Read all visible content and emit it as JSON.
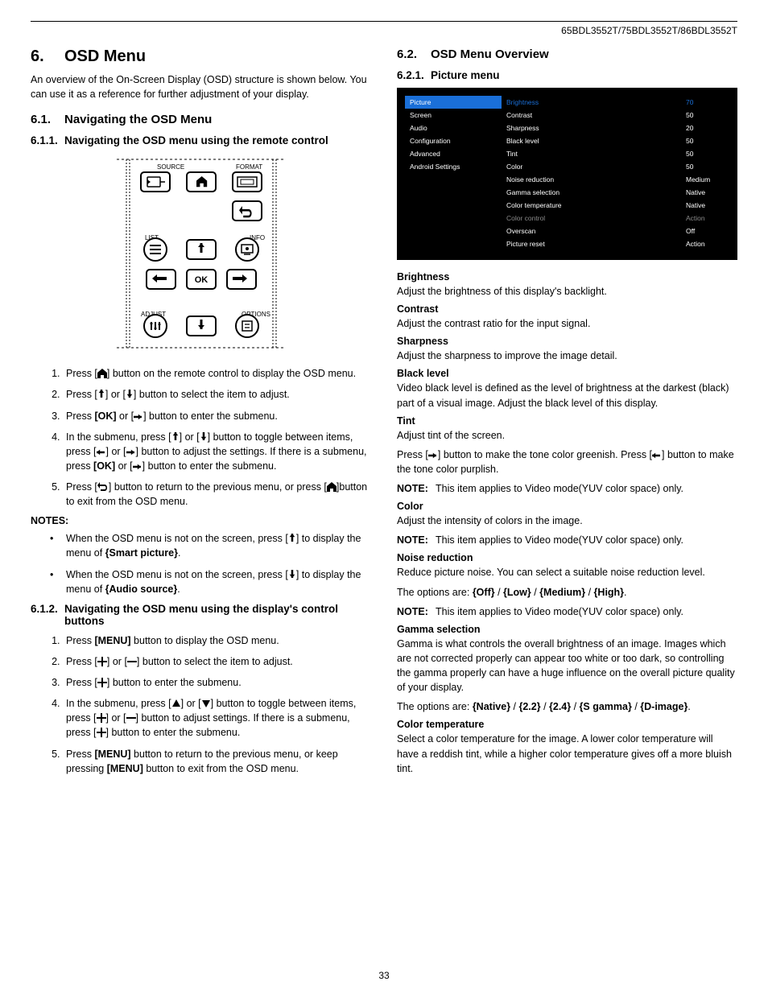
{
  "header": {
    "models": "65BDL3552T/75BDL3552T/86BDL3552T"
  },
  "page_number": "33",
  "left": {
    "h1_num": "6.",
    "h1_title": "OSD Menu",
    "intro": "An overview of the On-Screen Display (OSD) structure is shown below. You can use it as a reference for further adjustment of your display.",
    "s61_num": "6.1.",
    "s61_title": "Navigating  the OSD Menu",
    "s611_num": "6.1.1.",
    "s611_title": "Navigating the OSD menu using the remote control",
    "remote_labels": {
      "source": "SOURCE",
      "format": "FORMAT",
      "list": "LIST",
      "info": "INFO",
      "adjust": "ADJUST",
      "options": "OPTIONS",
      "ok": "OK"
    },
    "steps611": {
      "s1a": "Press [",
      "s1b": "] button on the remote control to display the OSD menu.",
      "s2a": "Press [",
      "s2b": "] or [",
      "s2c": "] button to select the item to adjust.",
      "s3a": "Press ",
      "s3b": "[OK]",
      "s3c": " or [",
      "s3d": "] button to enter the submenu.",
      "s4a": "In the submenu, press [",
      "s4b": "] or [",
      "s4c": "] button to toggle between items, press [",
      "s4d": "] or [",
      "s4e": "] button to adjust the settings. If there is a submenu, press ",
      "s4f": "[OK]",
      "s4g": " or [",
      "s4h": "] button to enter the submenu.",
      "s5a": "Press [",
      "s5b": "] button to return to the previous menu, or press [",
      "s5c": "]button to exit from the OSD menu."
    },
    "notes_hd": "NOTES:",
    "notes": {
      "n1a": "When the OSD menu is not on the screen, press [",
      "n1b": "] to display the menu of ",
      "n1c": "{Smart picture}",
      "n1d": ".",
      "n2a": "When the OSD menu is not on the screen, press [",
      "n2b": "] to display the menu of ",
      "n2c": "{Audio source}",
      "n2d": "."
    },
    "s612_num": "6.1.2.",
    "s612_title": "Navigating the OSD menu using the display's control buttons",
    "steps612": {
      "s1a": "Press ",
      "s1b": "[MENU]",
      "s1c": " button to display the OSD menu.",
      "s2a": "Press [",
      "s2b": "] or [",
      "s2c": "] button to select the item to adjust.",
      "s3a": "Press [",
      "s3b": "] button to enter the submenu.",
      "s4a": "In the submenu, press [",
      "s4b": "] or [",
      "s4c": "] button to toggle between items, press [",
      "s4d": "] or [",
      "s4e": "] button to adjust settings. If there is a submenu, press [",
      "s4f": "] button to enter the submenu.",
      "s5a": "Press ",
      "s5b": "[MENU]",
      "s5c": " button to return to the previous menu, or keep pressing ",
      "s5d": "[MENU]",
      "s5e": " button to exit from the OSD menu."
    }
  },
  "right": {
    "s62_num": "6.2.",
    "s62_title": "OSD Menu Overview",
    "s621_num": "6.2.1.",
    "s621_title": "Picture menu",
    "osd": {
      "left_items": [
        "Picture",
        "Screen",
        "Audio",
        "Configuration",
        "Advanced",
        "Android Settings"
      ],
      "rows": [
        {
          "label": "Brightness",
          "val": "70",
          "sel": true
        },
        {
          "label": "Contrast",
          "val": "50"
        },
        {
          "label": "Sharpness",
          "val": "20"
        },
        {
          "label": "Black level",
          "val": "50"
        },
        {
          "label": "Tint",
          "val": "50"
        },
        {
          "label": "Color",
          "val": "50"
        },
        {
          "label": "Noise reduction",
          "val": "Medium"
        },
        {
          "label": "Gamma selection",
          "val": "Native"
        },
        {
          "label": "Color temperature",
          "val": "Native"
        },
        {
          "label": "Color control",
          "val": "Action",
          "dim": true
        },
        {
          "label": "Overscan",
          "val": "Off"
        },
        {
          "label": "Picture reset",
          "val": "Action"
        }
      ]
    },
    "defs": {
      "brightness_h": "Brightness",
      "brightness_b": "Adjust the brightness of this display's backlight.",
      "contrast_h": "Contrast",
      "contrast_b": "Adjust the contrast ratio for the input signal.",
      "sharpness_h": "Sharpness",
      "sharpness_b": "Adjust the sharpness to improve the image detail.",
      "black_h": "Black level",
      "black_b": "Video black level is defined as the level of brightness at the darkest (black) part of a visual image. Adjust the black level of this display.",
      "tint_h": "Tint",
      "tint_b1": "Adjust tint of the screen.",
      "tint_b2a": "Press [",
      "tint_b2b": "] button to make the tone color greenish. Press [",
      "tint_b2c": "] button to make the tone color purplish.",
      "tint_note": "This item applies to Video mode(YUV color space) only.",
      "color_h": "Color",
      "color_b": "Adjust the intensity of colors in the image.",
      "color_note": "This item applies to Video mode(YUV color space) only.",
      "noise_h": "Noise reduction",
      "noise_b": "Reduce picture noise. You can select a suitable noise reduction level.",
      "noise_opts_a": "The options are: ",
      "noise_opts_b": "{Off}",
      "noise_opts_c": " / ",
      "noise_opts_d": "{Low}",
      "noise_opts_e": " / ",
      "noise_opts_f": "{Medium}",
      "noise_opts_g": " / ",
      "noise_opts_h": "{High}",
      "noise_opts_i": ".",
      "noise_note": "This item applies to Video mode(YUV color space) only.",
      "gamma_h": "Gamma selection",
      "gamma_b": "Gamma is what controls the overall brightness of an image. Images which are not corrected  properly can appear too white or too dark, so controlling the gamma properly can have a huge influence on the overall picture quality of your display.",
      "gamma_opts_a": "The options are: ",
      "gamma_opts_b": "{Native}",
      "gamma_opts_c": " / ",
      "gamma_opts_d": "{2.2}",
      "gamma_opts_e": " / ",
      "gamma_opts_f": "{2.4}",
      "gamma_opts_g": " / ",
      "gamma_opts_h": "{S gamma}",
      "gamma_opts_i": " / ",
      "gamma_opts_j": "{D-image}",
      "gamma_opts_k": ".",
      "ct_h": "Color temperature",
      "ct_b": "Select a color temperature for the image. A lower color temperature will have a reddish tint, while a higher color temperature gives off a more bluish tint.",
      "note_label": "NOTE:"
    }
  }
}
